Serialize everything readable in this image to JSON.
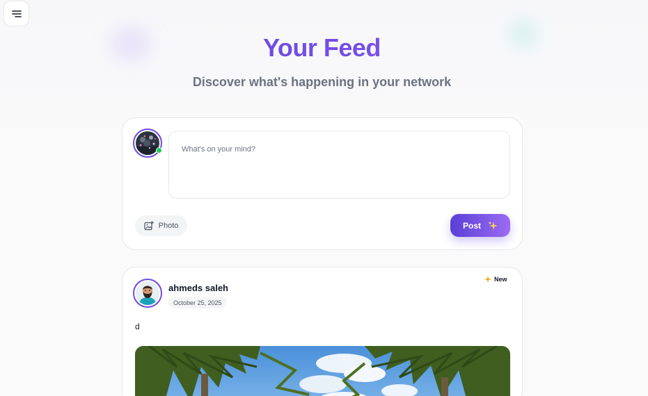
{
  "header": {
    "title": "Your Feed",
    "subtitle": "Discover what's happening in your network"
  },
  "composer": {
    "placeholder": "What's on your mind?",
    "photo_label": "Photo",
    "post_label": "Post"
  },
  "post": {
    "author": "ahmeds saleh",
    "date": "October 25, 2025",
    "badge": "New",
    "text": "d"
  },
  "colors": {
    "accent": "#6d4ae0",
    "accent_light": "#9b6bf2",
    "online": "#22c55e",
    "sparkle": "#f59e0b"
  },
  "icons": {
    "menu": "menu-icon",
    "photo": "image-plus-icon",
    "post": "sparkles-icon",
    "new": "sparkle-icon"
  }
}
